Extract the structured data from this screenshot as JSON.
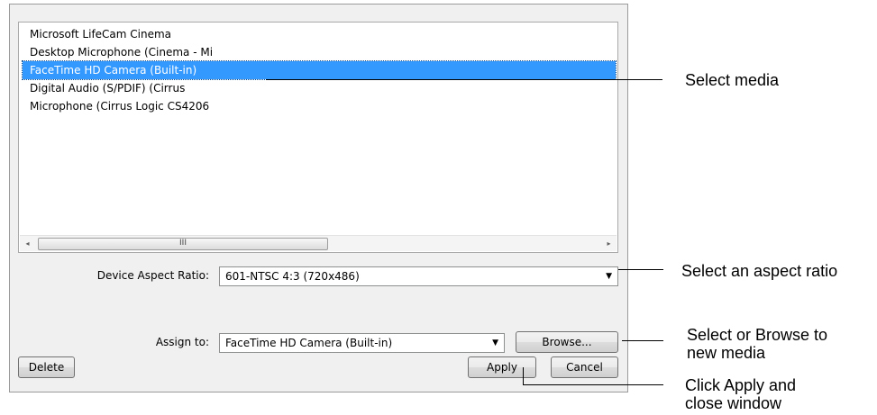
{
  "devices": [
    {
      "label": "Microsoft LifeCam Cinema",
      "selected": false
    },
    {
      "label": "Desktop Microphone (Cinema - Mi",
      "selected": false
    },
    {
      "label": "FaceTime HD Camera (Built-in)",
      "selected": true
    },
    {
      "label": "Digital Audio (S/PDIF) (Cirrus",
      "selected": false
    },
    {
      "label": "Microphone (Cirrus Logic CS4206",
      "selected": false
    }
  ],
  "scrollbar": {
    "left_arrow": "◂",
    "right_arrow": "▸",
    "grip": "III"
  },
  "aspect": {
    "label": "Device Aspect Ratio:",
    "value": "601-NTSC 4:3 (720x486)",
    "arrow": "▼"
  },
  "assign": {
    "label": "Assign to:",
    "value": "FaceTime HD Camera (Built-in)",
    "arrow": "▼"
  },
  "buttons": {
    "browse": "Browse...",
    "delete": "Delete",
    "apply": "Apply",
    "cancel": "Cancel"
  },
  "annotations": {
    "select_media": "Select media",
    "select_aspect": "Select an aspect ratio",
    "browse_line1": "Select or Browse to",
    "browse_line2": "new media",
    "apply_line1": "Click Apply and",
    "apply_line2": "close window"
  }
}
